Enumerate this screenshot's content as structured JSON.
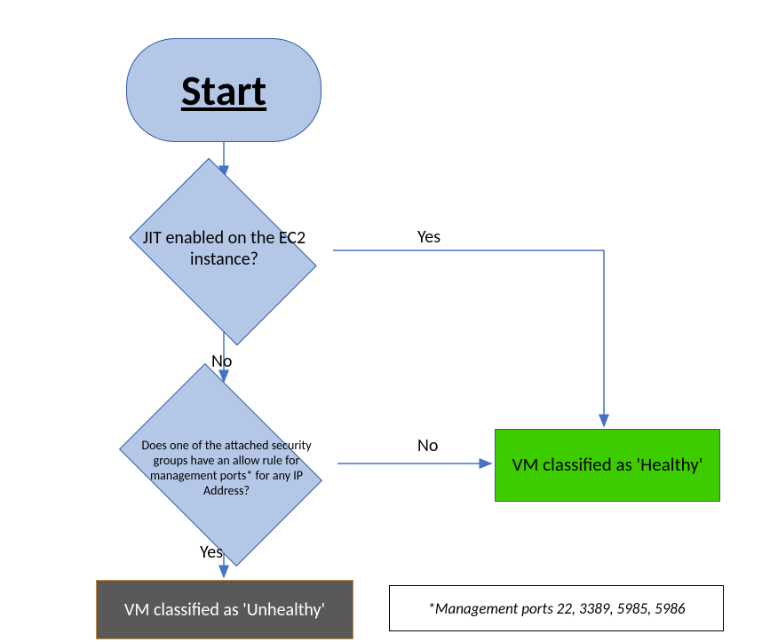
{
  "nodes": {
    "start": "Start",
    "decision1": "JIT enabled on the EC2 instance?",
    "decision2": "Does one of the attached security groups have an allow rule for management ports* for any IP Address?",
    "unhealthy": "VM classified as 'Unhealthy'",
    "healthy": "VM classified as 'Healthy'",
    "note": "*Management ports 22, 3389, 5985, 5986"
  },
  "labels": {
    "d1_yes": "Yes",
    "d1_no": "No",
    "d2_no": "No",
    "d2_yes": "Yes"
  },
  "chart_data": {
    "type": "diagram",
    "flow_type": "flowchart",
    "nodes": [
      {
        "id": "start",
        "type": "terminator",
        "text": "Start"
      },
      {
        "id": "d1",
        "type": "decision",
        "text": "JIT enabled on the EC2 instance?"
      },
      {
        "id": "d2",
        "type": "decision",
        "text": "Does one of the attached security groups have an allow rule for management ports* for any IP Address?"
      },
      {
        "id": "unhealthy",
        "type": "process",
        "text": "VM classified as 'Unhealthy'",
        "fill": "#595959"
      },
      {
        "id": "healthy",
        "type": "process",
        "text": "VM classified as 'Healthy'",
        "fill": "#3dcc00"
      },
      {
        "id": "note",
        "type": "annotation",
        "text": "*Management ports 22, 3389, 5985, 5986"
      }
    ],
    "edges": [
      {
        "from": "start",
        "to": "d1",
        "label": ""
      },
      {
        "from": "d1",
        "to": "healthy",
        "label": "Yes"
      },
      {
        "from": "d1",
        "to": "d2",
        "label": "No"
      },
      {
        "from": "d2",
        "to": "healthy",
        "label": "No"
      },
      {
        "from": "d2",
        "to": "unhealthy",
        "label": "Yes"
      }
    ]
  }
}
